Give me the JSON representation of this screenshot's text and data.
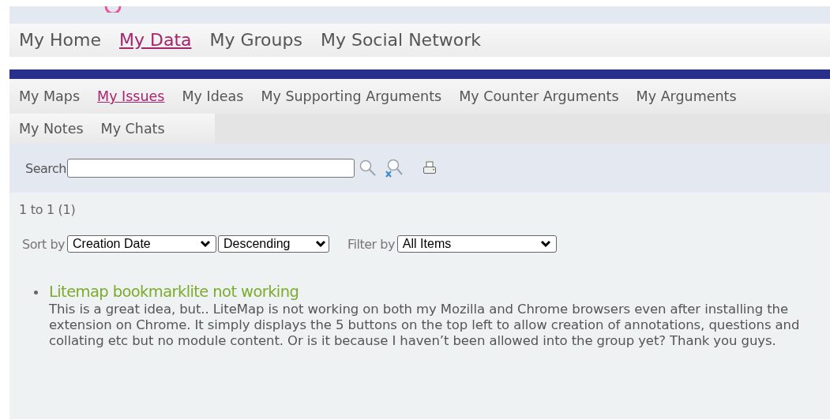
{
  "main_nav": [
    {
      "label": "My Home",
      "selected": false
    },
    {
      "label": "My Data",
      "selected": true
    },
    {
      "label": "My Groups",
      "selected": false
    },
    {
      "label": "My Social Network",
      "selected": false
    }
  ],
  "sub_nav": [
    {
      "label": "My Maps",
      "selected": false
    },
    {
      "label": "My Issues",
      "selected": true
    },
    {
      "label": "My Ideas",
      "selected": false
    },
    {
      "label": "My Supporting Arguments",
      "selected": false
    },
    {
      "label": "My Counter Arguments",
      "selected": false
    },
    {
      "label": "My Arguments",
      "selected": false
    },
    {
      "label": "My Notes",
      "selected": false
    },
    {
      "label": "My Chats",
      "selected": false
    }
  ],
  "search": {
    "label": "Search"
  },
  "count": "1 to 1 (1)",
  "sort": {
    "label": "Sort by",
    "field": "Creation Date",
    "order": "Descending"
  },
  "filter": {
    "label": "Filter by",
    "value": "All Items"
  },
  "items": [
    {
      "title": "Litemap bookmarklite not working",
      "description": "This is a great idea, but.. LiteMap is not working on both my Mozilla and Chrome browsers even after installing the extension on Chrome. It simply displays the 5 buttons on the top left to allow creation of annotations, questions and collating etc but no module content. Or is it because I haven’t been allowed into the group yet? Thank you guys."
    }
  ]
}
